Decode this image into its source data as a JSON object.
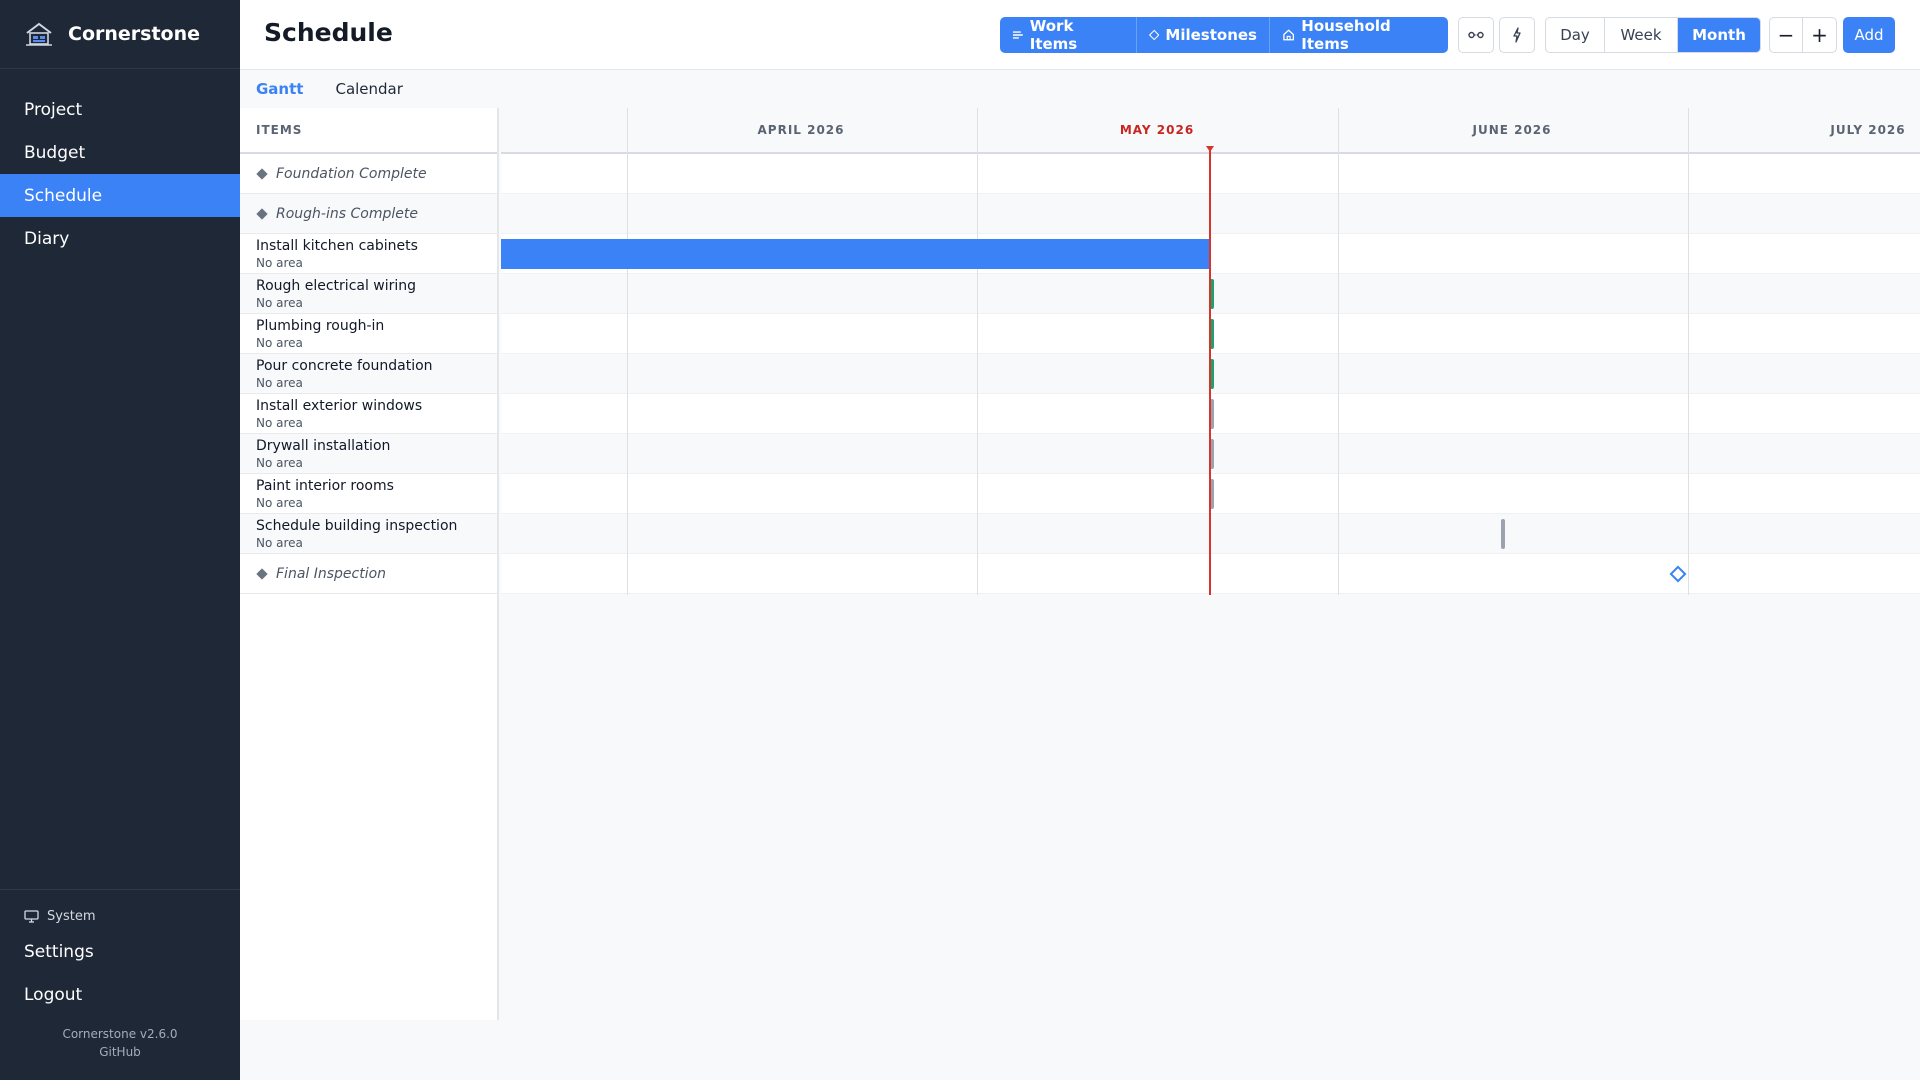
{
  "app": {
    "name": "Cornerstone",
    "version": "Cornerstone v2.6.0",
    "github_label": "GitHub"
  },
  "sidebar": {
    "items": [
      {
        "label": "Project"
      },
      {
        "label": "Budget"
      },
      {
        "label": "Schedule",
        "active": true
      },
      {
        "label": "Diary"
      }
    ],
    "system_label": "System",
    "settings_label": "Settings",
    "logout_label": "Logout"
  },
  "header": {
    "title": "Schedule",
    "filters": {
      "work_items": "Work Items",
      "milestones": "Milestones",
      "household_items": "Household Items"
    },
    "view": {
      "day": "Day",
      "week": "Week",
      "month": "Month",
      "selected": "Month"
    },
    "zoom_out": "−",
    "zoom_in": "+",
    "add": "Add"
  },
  "tabs": [
    {
      "label": "Gantt",
      "active": true
    },
    {
      "label": "Calendar",
      "active": false
    }
  ],
  "gantt": {
    "items_header": "ITEMS",
    "months": [
      "APRIL 2026",
      "MAY 2026",
      "JUNE 2026",
      "JULY 2026"
    ],
    "current_month": "MAY 2026",
    "rows": [
      {
        "type": "milestone",
        "title": "Foundation Complete"
      },
      {
        "type": "milestone",
        "title": "Rough-ins Complete"
      },
      {
        "type": "task",
        "title": "Install kitchen cabinets",
        "area": "No area",
        "status": "in-progress"
      },
      {
        "type": "task",
        "title": "Rough electrical wiring",
        "area": "No area",
        "status": "completed"
      },
      {
        "type": "task",
        "title": "Plumbing rough-in",
        "area": "No area",
        "status": "completed"
      },
      {
        "type": "task",
        "title": "Pour concrete foundation",
        "area": "No area",
        "status": "completed"
      },
      {
        "type": "task",
        "title": "Install exterior windows",
        "area": "No area",
        "status": "not-started"
      },
      {
        "type": "task",
        "title": "Drywall installation",
        "area": "No area",
        "status": "not-started"
      },
      {
        "type": "task",
        "title": "Paint interior rooms",
        "area": "No area",
        "status": "not-started"
      },
      {
        "type": "task",
        "title": "Schedule building inspection",
        "area": "No area",
        "status": "not-started"
      },
      {
        "type": "milestone",
        "title": "Final Inspection"
      }
    ]
  },
  "colors": {
    "accent": "#3b82f6",
    "sidebar_bg": "#1f2837",
    "today_line": "#d9342b",
    "completed": "#22a06b",
    "not_started": "#9ca3af"
  }
}
